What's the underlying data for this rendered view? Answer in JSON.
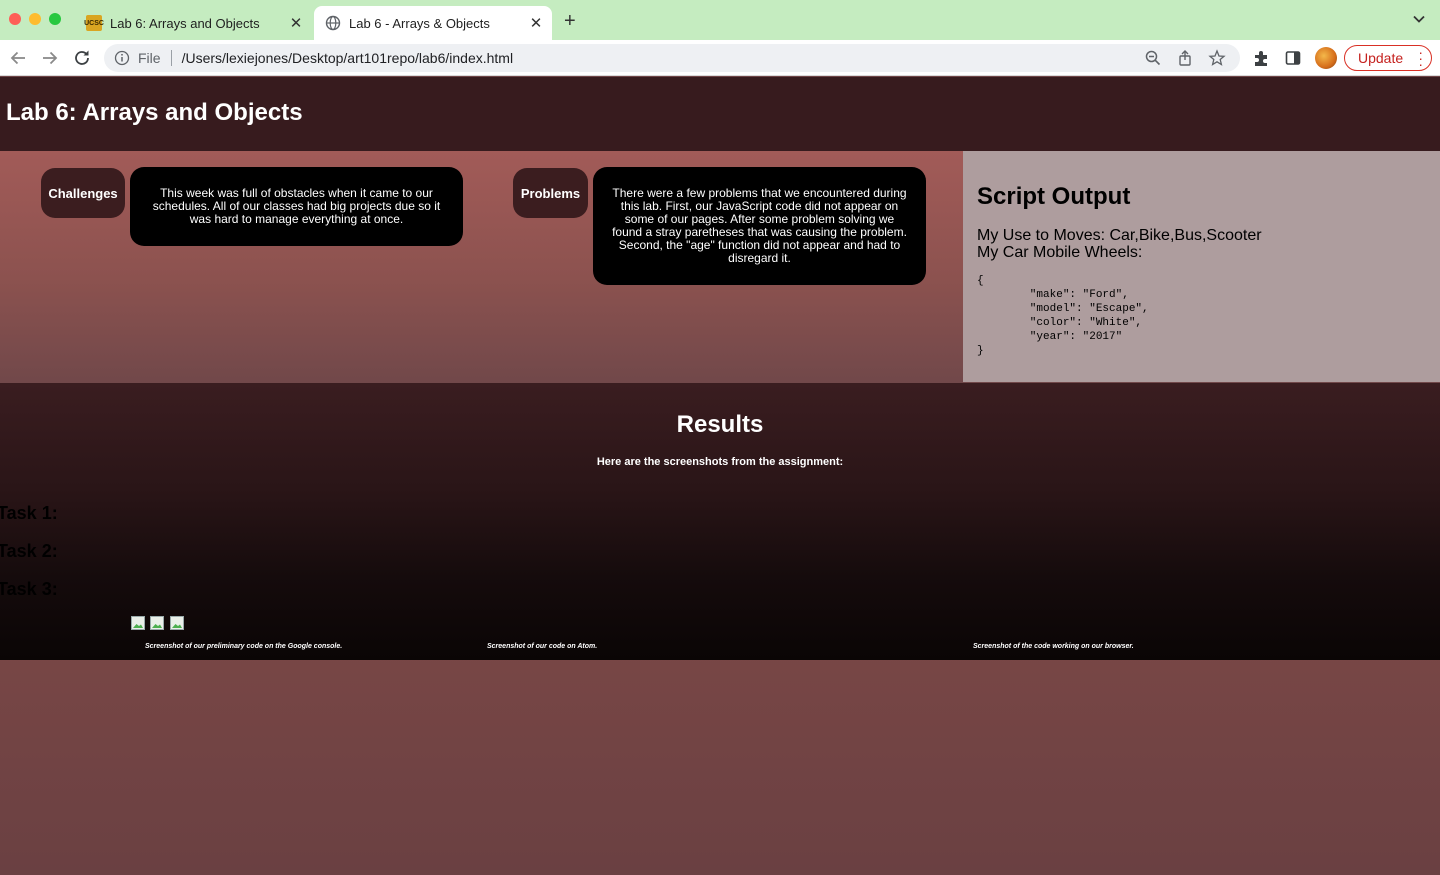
{
  "browser": {
    "tabs": [
      {
        "title": "Lab 6: Arrays and Objects",
        "favicon": "ucsc-favicon",
        "active": false
      },
      {
        "title": "Lab 6 - Arrays & Objects",
        "favicon": "globe-icon",
        "active": true
      }
    ],
    "new_tab_label": "+",
    "omnibox": {
      "scheme_label": "File",
      "url": "/Users/lexiejones/Desktop/art101repo/lab6/index.html"
    },
    "update_label": "Update"
  },
  "page": {
    "title": "Lab 6: Arrays and Objects",
    "challenges": {
      "label": "Challenges",
      "text": "This week was full of obstacles when it came to our schedules. All of our classes had big projects due so it was hard to manage everything at once."
    },
    "problems": {
      "label": "Problems",
      "text": "There were a few problems that we encountered during this lab. First, our JavaScript code did not appear on some of our pages. After some problem solving we found a stray paretheses that was causing the problem. Second, the \"age\" function did not appear and had to disregard it."
    },
    "script_output": {
      "title": "Script Output",
      "moves_line": "My Use to Moves: Car,Bike,Bus,Scooter",
      "wheels_line": "My Car Mobile Wheels:",
      "json_text": "{\n        \"make\": \"Ford\",\n        \"model\": \"Escape\",\n        \"color\": \"White\",\n        \"year\": \"2017\"\n}"
    },
    "results": {
      "title": "Results",
      "subtitle": "Here are the screenshots from the assignment:",
      "tasks": [
        "Task 1:",
        "Task 2:",
        "Task 3:"
      ],
      "captions": [
        "Screenshot of our preliminary code on the Google console.",
        "Screenshot of our code on Atom.",
        "Screenshot of the code working on our browser."
      ]
    }
  },
  "colors": {
    "header_bg": "#371b1e",
    "tabstrip_bg": "#c5ecc0",
    "script_panel_bg": "#ae9d9e",
    "update_accent": "#d93025"
  }
}
